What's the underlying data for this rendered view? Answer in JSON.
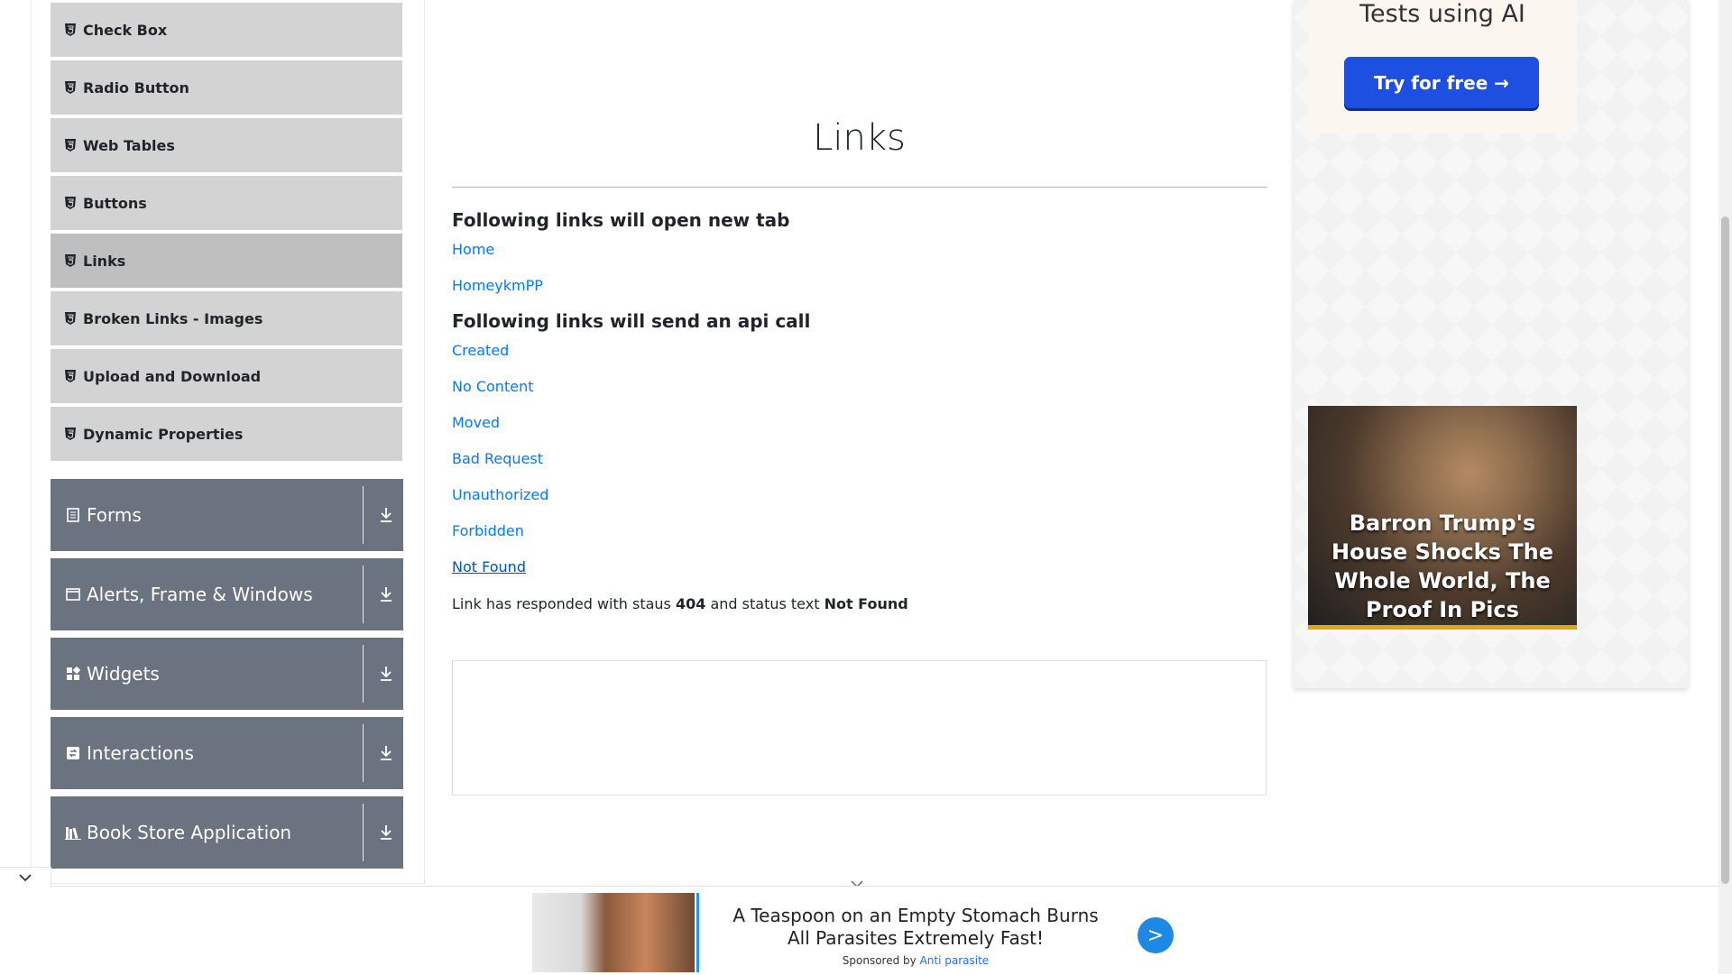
{
  "sidebar": {
    "element_items": [
      {
        "label": "Check Box",
        "icon": "html5-icon"
      },
      {
        "label": "Radio Button",
        "icon": "html5-icon"
      },
      {
        "label": "Web Tables",
        "icon": "html5-icon"
      },
      {
        "label": "Buttons",
        "icon": "html5-icon"
      },
      {
        "label": "Links",
        "icon": "html5-icon",
        "active": true
      },
      {
        "label": "Broken Links - Images",
        "icon": "html5-icon"
      },
      {
        "label": "Upload and Download",
        "icon": "html5-icon"
      },
      {
        "label": "Dynamic Properties",
        "icon": "html5-icon"
      }
    ],
    "groups": [
      {
        "label": "Forms",
        "icon": "form-icon"
      },
      {
        "label": "Alerts, Frame & Windows",
        "icon": "window-icon"
      },
      {
        "label": "Widgets",
        "icon": "widgets-icon"
      },
      {
        "label": "Interactions",
        "icon": "interactions-icon"
      },
      {
        "label": "Book Store Application",
        "icon": "books-icon"
      }
    ]
  },
  "main": {
    "title": "Links",
    "section_new_tab": "Following links will open new tab",
    "new_tab_links": [
      "Home",
      "HomeykmPP"
    ],
    "section_api": "Following links will send an api call",
    "api_links": [
      "Created",
      "No Content",
      "Moved",
      "Bad Request",
      "Unauthorized",
      "Forbidden",
      "Not Found"
    ],
    "response": {
      "prefix": "Link has responded with staus",
      "status_code": "404",
      "middle": "and status text",
      "status_text": "Not Found"
    }
  },
  "right_ad": {
    "promo_text": "Tests using AI",
    "promo_button": "Try for free →",
    "photo_caption": "Barron Trump's House Shocks The Whole World, The Proof In Pics"
  },
  "bottom_ad": {
    "headline": "A Teaspoon on an Empty Stomach Burns All Parasites Extremely Fast!",
    "sponsored_by": "Sponsored by",
    "brand": "Anti parasite",
    "go_label": ">"
  },
  "colors": {
    "link": "#007bff",
    "menu_bg": "#d3d3d3",
    "menu_active_bg": "#bfbfbf",
    "group_bg": "#6b7280",
    "promo_button": "#1d4fe0"
  }
}
